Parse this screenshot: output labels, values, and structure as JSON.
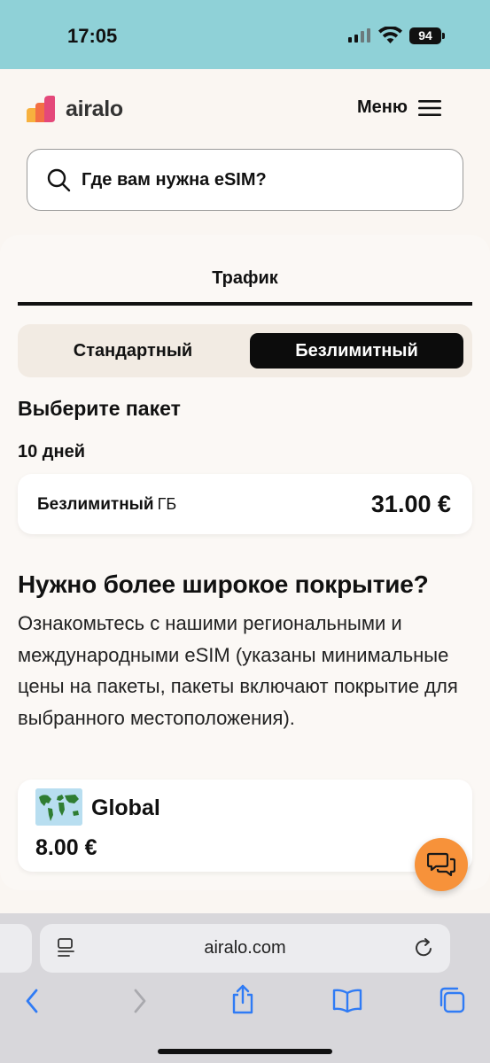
{
  "status_bar": {
    "time": "17:05",
    "battery": "94"
  },
  "header": {
    "logo_text": "airalo",
    "menu_label": "Меню",
    "search_placeholder": "Где вам нужна eSIM?"
  },
  "tabs": {
    "traffic": "Трафик"
  },
  "segment": {
    "standard": "Стандартный",
    "unlimited": "Безлимитный",
    "selected": "unlimited"
  },
  "packages_section": {
    "title": "Выберите пакет",
    "group_label": "10 дней",
    "items": [
      {
        "name": "Безлимитный",
        "unit": "ГБ",
        "price": "31.00 €"
      }
    ]
  },
  "coverage_section": {
    "title": "Нужно более широкое покрытие?",
    "text": "Ознакомьтесь с нашими региональными и международными eSIM (указаны минимальные цены на пакеты, пакеты включают покрытие для выбранного местоположения).",
    "global": {
      "name": "Global",
      "price": "8.00 €"
    }
  },
  "browser": {
    "url": "airalo.com"
  },
  "colors": {
    "status_bar_bg": "#8fd1d7",
    "accent_orange": "#f7923a",
    "selected_segment_bg": "#0c0c0c",
    "ios_link_blue": "#2f7bf5"
  },
  "icons": [
    "search-icon",
    "hamburger-icon",
    "chat-icon",
    "world-map-icon",
    "back-icon",
    "forward-icon",
    "share-icon",
    "bookmarks-icon",
    "tabs-icon",
    "reload-icon",
    "reader-icon"
  ]
}
